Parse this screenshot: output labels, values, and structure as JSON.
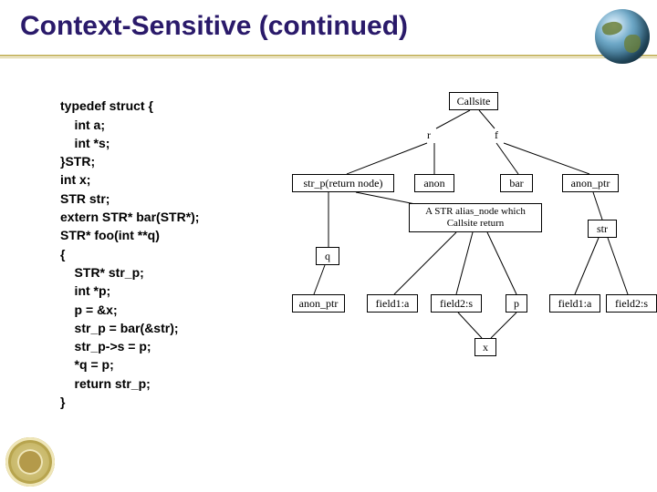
{
  "title": "Context-Sensitive (continued)",
  "code_lines": [
    "typedef struct {",
    "    int a;",
    "    int *s;",
    "}STR;",
    "int x;",
    "STR str;",
    "extern STR* bar(STR*);",
    "STR* foo(int **q)",
    "{",
    "    STR* str_p;",
    "    int *p;",
    "    p = &x;",
    "    str_p = bar(&str);",
    "    str_p->s = p;",
    "    *q = p;",
    "    return str_p;",
    "}"
  ],
  "diagram": {
    "nodes": {
      "callsite": "Callsite",
      "r": "r",
      "f": "f",
      "strp_ret": "str_p(return node)",
      "anon": "anon",
      "bar": "bar",
      "anon_ptr_top": "anon_ptr",
      "q": "q",
      "note": "A STR alias_node which Callsite return",
      "str": "str",
      "anon_ptr_l": "anon_ptr",
      "field1a_l": "field1:a",
      "field2s_l": "field2:s",
      "p": "p",
      "field1a_r": "field1:a",
      "field2s_r": "field2:s",
      "x": "x"
    }
  },
  "chart_data": {
    "type": "diagram",
    "title": "Context-Sensitive pointer analysis graph",
    "nodes": [
      {
        "id": "callsite",
        "label": "Callsite"
      },
      {
        "id": "r",
        "label": "r"
      },
      {
        "id": "f",
        "label": "f"
      },
      {
        "id": "strp_ret",
        "label": "str_p(return node)"
      },
      {
        "id": "anon",
        "label": "anon"
      },
      {
        "id": "bar",
        "label": "bar"
      },
      {
        "id": "anon_ptr_top",
        "label": "anon_ptr"
      },
      {
        "id": "q",
        "label": "q"
      },
      {
        "id": "str_alias",
        "label": "A STR alias_node which Callsite return"
      },
      {
        "id": "str",
        "label": "str"
      },
      {
        "id": "anon_ptr_l",
        "label": "anon_ptr"
      },
      {
        "id": "field1a_l",
        "label": "field1:a"
      },
      {
        "id": "field2s_l",
        "label": "field2:s"
      },
      {
        "id": "p",
        "label": "p"
      },
      {
        "id": "field1a_r",
        "label": "field1:a"
      },
      {
        "id": "field2s_r",
        "label": "field2:s"
      },
      {
        "id": "x",
        "label": "x"
      }
    ],
    "edges": [
      [
        "callsite",
        "r"
      ],
      [
        "callsite",
        "f"
      ],
      [
        "r",
        "strp_ret"
      ],
      [
        "r",
        "anon"
      ],
      [
        "f",
        "bar"
      ],
      [
        "f",
        "anon_ptr_top"
      ],
      [
        "strp_ret",
        "q"
      ],
      [
        "strp_ret",
        "str_alias"
      ],
      [
        "anon_ptr_top",
        "str"
      ],
      [
        "q",
        "anon_ptr_l"
      ],
      [
        "str_alias",
        "field1a_l"
      ],
      [
        "str_alias",
        "field2s_l"
      ],
      [
        "str_alias",
        "p"
      ],
      [
        "str",
        "field1a_r"
      ],
      [
        "str",
        "field2s_r"
      ],
      [
        "field2s_l",
        "x"
      ],
      [
        "p",
        "x"
      ]
    ]
  }
}
